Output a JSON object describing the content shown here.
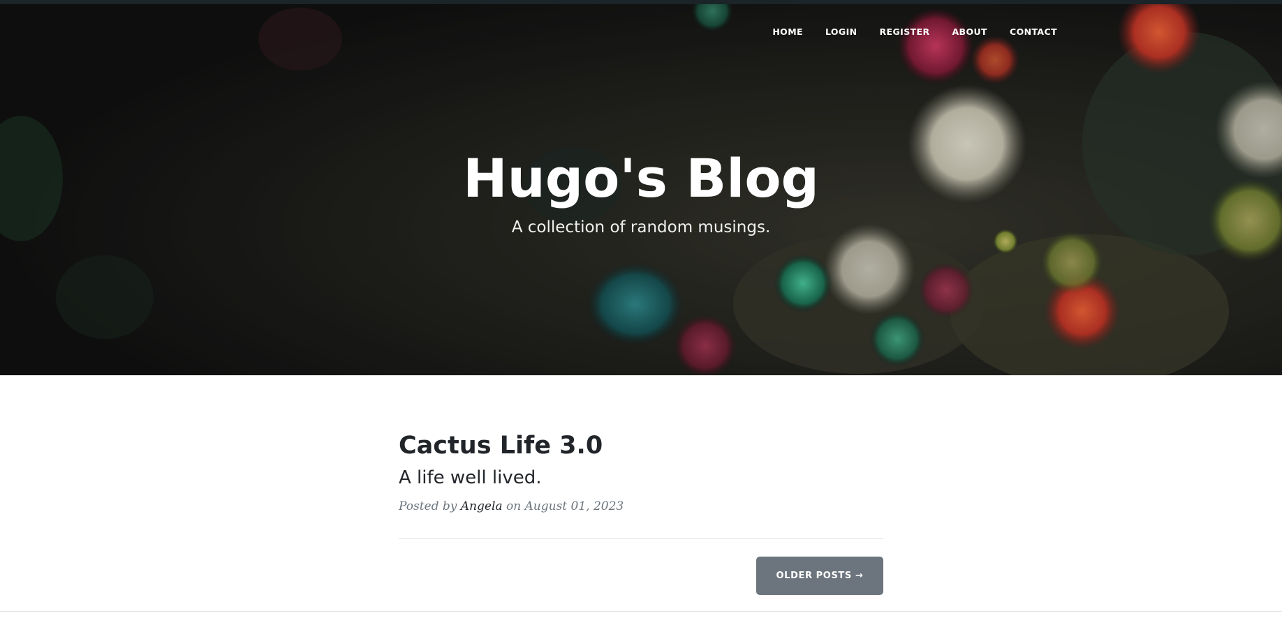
{
  "nav": {
    "items": [
      "HOME",
      "LOGIN",
      "REGISTER",
      "ABOUT",
      "CONTACT"
    ]
  },
  "header": {
    "title": "Hugo's Blog",
    "subtitle": "A collection of random musings.",
    "background": "dark aquarium photo with sea anemones"
  },
  "posts": [
    {
      "title": "Cactus Life 3.0",
      "subtitle": "A life well lived.",
      "meta_prefix": "Posted by",
      "author": "Angela",
      "meta_on": "on",
      "date": "August 01, 2023"
    }
  ],
  "pager": {
    "older_label": "OLDER POSTS →"
  },
  "colors": {
    "button": "#6c757d",
    "text_dark": "#212529",
    "meta_gray": "#6c757d",
    "divider": "#dee2e6"
  }
}
